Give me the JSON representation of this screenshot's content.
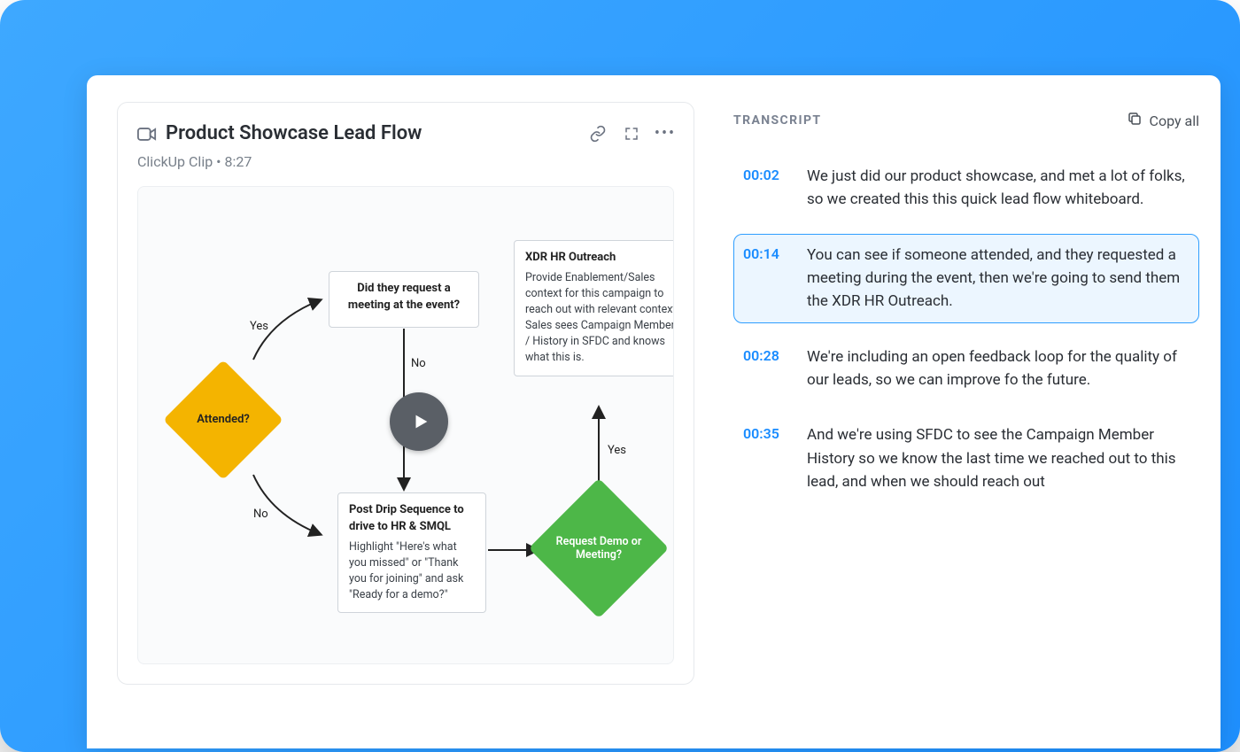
{
  "clip": {
    "title": "Product Showcase Lead Flow",
    "source": "ClickUp Clip",
    "duration": "8:27",
    "subline": "ClickUp Clip • 8:27"
  },
  "flow": {
    "attended_label": "Attended?",
    "attended_yes": "Yes",
    "attended_no": "No",
    "meeting_q_title": "Did they request a meeting at the event?",
    "meeting_no": "No",
    "xdr_title": "XDR HR Outreach",
    "xdr_body": "Provide Enablement/Sales context for this campaign to reach out with relevant context. Sales sees Campaign Member / History in SFDC and knows what this is.",
    "drip_title": "Post Drip Sequence to drive to HR & SMQL",
    "drip_body": "Highlight \"Here's what you missed\" or \"Thank you for joining\" and ask \"Ready for a demo?\"",
    "demo_label": "Request Demo or Meeting?",
    "demo_yes": "Yes"
  },
  "transcript": {
    "header": "TRANSCRIPT",
    "copy_all_label": "Copy all",
    "items": [
      {
        "time": "00:02",
        "text": "We just did our product showcase, and met a lot of folks, so we created this this quick lead flow whiteboard."
      },
      {
        "time": "00:14",
        "text": "You can see if someone attended, and they requested a meeting during the event, then we're going to send them the XDR HR Outreach."
      },
      {
        "time": "00:28",
        "text": "We're including an open feedback loop for the quality of our leads, so we can improve fo the future."
      },
      {
        "time": "00:35",
        "text": "And we're using SFDC to see the Campaign Member History so we know the last time we reached out to this lead, and when we should reach out"
      }
    ],
    "active_index": 1
  }
}
